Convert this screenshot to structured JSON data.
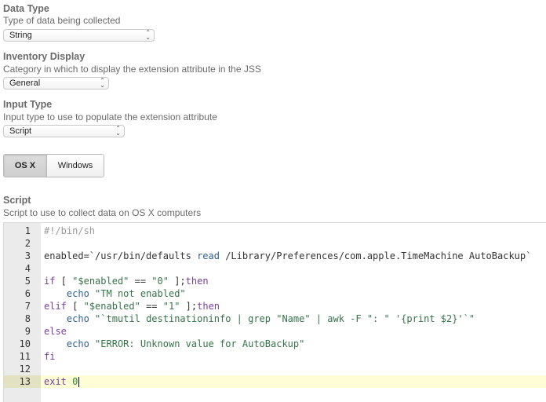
{
  "data_type": {
    "title": "Data Type",
    "desc": "Type of data being collected",
    "value": "String"
  },
  "inventory_display": {
    "title": "Inventory Display",
    "desc": "Category in which to display the extension attribute in the JSS",
    "value": "General"
  },
  "input_type": {
    "title": "Input Type",
    "desc": "Input type to use to populate the extension attribute",
    "value": "Script"
  },
  "platform_tabs": {
    "selected": "OS X",
    "items": [
      "OS X",
      "Windows"
    ]
  },
  "script": {
    "title": "Script",
    "desc": "Script to use to collect data on OS X computers",
    "active_line": 13,
    "lines": [
      {
        "n": "1",
        "tokens": [
          [
            "c-comment",
            "#!/bin/sh"
          ]
        ]
      },
      {
        "n": "2",
        "tokens": []
      },
      {
        "n": "3",
        "tokens": [
          [
            "",
            "enabled=`/usr/bin/defaults "
          ],
          [
            "c-cmd",
            "read"
          ],
          [
            "",
            " /Library/Preferences/com.apple.TimeMachine AutoBackup`"
          ]
        ]
      },
      {
        "n": "4",
        "tokens": []
      },
      {
        "n": "5",
        "tokens": [
          [
            "c-kw",
            "if"
          ],
          [
            "",
            " [ "
          ],
          [
            "c-str",
            "\"$enabled\""
          ],
          [
            "",
            " == "
          ],
          [
            "c-str",
            "\"0\""
          ],
          [
            "",
            " ];"
          ],
          [
            "c-kw",
            "then"
          ]
        ]
      },
      {
        "n": "6",
        "tokens": [
          [
            "",
            "    "
          ],
          [
            "c-cmd",
            "echo"
          ],
          [
            "",
            " "
          ],
          [
            "c-str",
            "\"TM not enabled\""
          ]
        ]
      },
      {
        "n": "7",
        "tokens": [
          [
            "c-kw",
            "elif"
          ],
          [
            "",
            " [ "
          ],
          [
            "c-str",
            "\"$enabled\""
          ],
          [
            "",
            " == "
          ],
          [
            "c-str",
            "\"1\""
          ],
          [
            "",
            " ];"
          ],
          [
            "c-kw",
            "then"
          ]
        ]
      },
      {
        "n": "8",
        "tokens": [
          [
            "",
            "    "
          ],
          [
            "c-cmd",
            "echo"
          ],
          [
            "",
            " "
          ],
          [
            "c-str",
            "\"`tmutil destinationinfo | grep \"Name\" | awk -F \": \" '{print $2}'`\""
          ]
        ]
      },
      {
        "n": "9",
        "tokens": [
          [
            "c-kw",
            "else"
          ]
        ]
      },
      {
        "n": "10",
        "tokens": [
          [
            "",
            "    "
          ],
          [
            "c-cmd",
            "echo"
          ],
          [
            "",
            " "
          ],
          [
            "c-str",
            "\"ERROR: Unknown value for AutoBackup\""
          ]
        ]
      },
      {
        "n": "11",
        "tokens": [
          [
            "c-kw",
            "fi"
          ]
        ]
      },
      {
        "n": "12",
        "tokens": []
      },
      {
        "n": "13",
        "tokens": [
          [
            "c-kw",
            "exit"
          ],
          [
            "",
            " "
          ],
          [
            "c-num",
            "0"
          ]
        ]
      }
    ]
  }
}
